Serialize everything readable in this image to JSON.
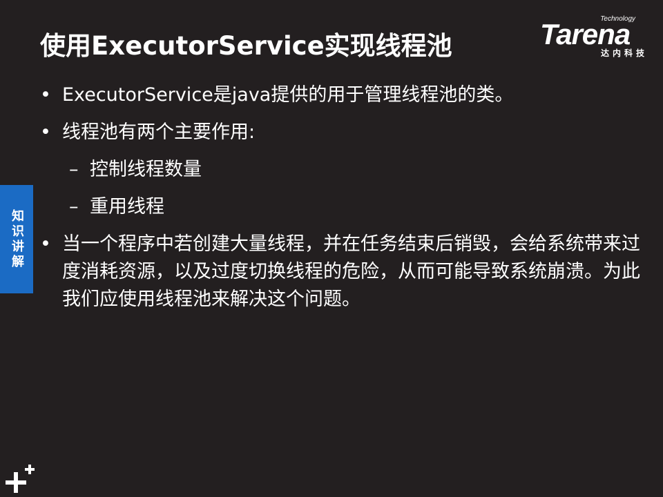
{
  "title": "使用ExecutorService实现线程池",
  "logo": {
    "small": "Technology",
    "word": "Tarena",
    "sub": "达内科技"
  },
  "side_tab": "知识讲解",
  "bullets": [
    {
      "bullet": "•",
      "text": "ExecutorService是java提供的用于管理线程池的类。"
    },
    {
      "bullet": "•",
      "text": "线程池有两个主要作用:"
    }
  ],
  "sub_bullets": [
    {
      "dash": "–",
      "text": "控制线程数量"
    },
    {
      "dash": "–",
      "text": "重用线程"
    }
  ],
  "last_bullet": {
    "bullet": "•",
    "text": "当一个程序中若创建大量线程，并在任务结束后销毁，会给系统带来过度消耗资源，以及过度切换线程的危险，从而可能导致系统崩溃。为此我们应使用线程池来解决这个问题。"
  },
  "colors": {
    "background": "#231f20",
    "accent": "#1b6bc4",
    "text": "#ffffff"
  }
}
